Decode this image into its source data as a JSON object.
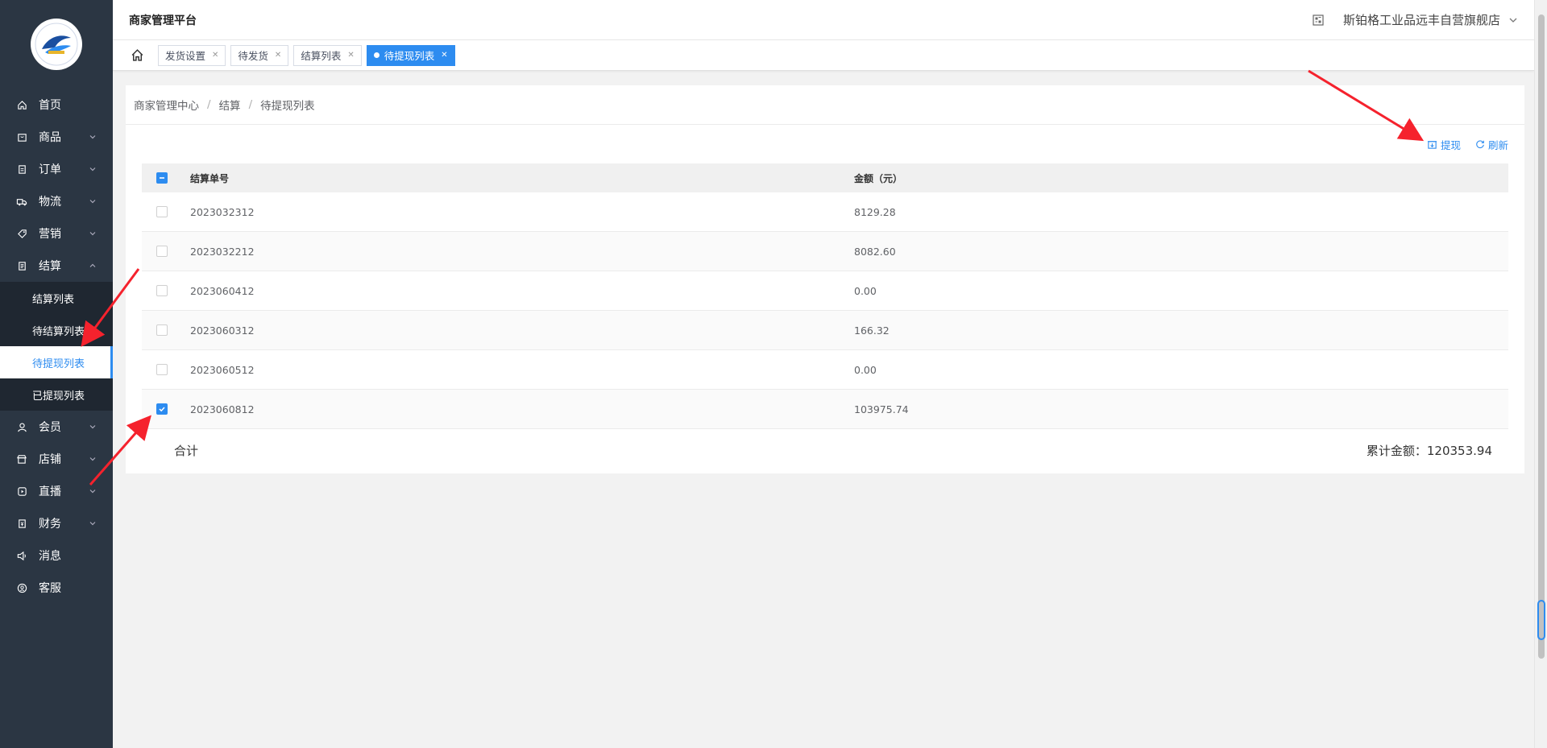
{
  "app": {
    "title": "商家管理平台",
    "shop_name": "斯铂格工业品远丰自营旗舰店"
  },
  "sidebar": {
    "items": [
      {
        "label": "首页",
        "icon": "home-icon"
      },
      {
        "label": "商品",
        "icon": "goods-icon"
      },
      {
        "label": "订单",
        "icon": "order-icon"
      },
      {
        "label": "物流",
        "icon": "truck-icon"
      },
      {
        "label": "营销",
        "icon": "tag-icon"
      },
      {
        "label": "结算",
        "icon": "settlement-icon"
      },
      {
        "label": "会员",
        "icon": "user-icon"
      },
      {
        "label": "店铺",
        "icon": "store-icon"
      },
      {
        "label": "直播",
        "icon": "live-icon"
      },
      {
        "label": "财务",
        "icon": "finance-icon"
      },
      {
        "label": "消息",
        "icon": "speaker-icon"
      },
      {
        "label": "客服",
        "icon": "service-icon"
      }
    ],
    "sub_items": [
      "结算列表",
      "待结算列表",
      "待提现列表",
      "已提现列表"
    ]
  },
  "tags": [
    "发货设置",
    "待发货",
    "结算列表",
    "待提现列表"
  ],
  "breadcrumb": [
    "商家管理中心",
    "结算",
    "待提现列表"
  ],
  "toolbar": {
    "withdraw": "提现",
    "refresh": "刷新"
  },
  "table": {
    "headers": {
      "id": "结算单号",
      "amount": "金额（元）"
    },
    "rows": [
      {
        "id": "2023032312",
        "amount": "8129.28"
      },
      {
        "id": "2023032212",
        "amount": "8082.60"
      },
      {
        "id": "2023060412",
        "amount": "0.00"
      },
      {
        "id": "2023060312",
        "amount": "166.32"
      },
      {
        "id": "2023060512",
        "amount": "0.00"
      },
      {
        "id": "2023060812",
        "amount": "103975.74"
      }
    ],
    "checked_rows": [
      false,
      false,
      false,
      false,
      false,
      true
    ]
  },
  "summary": {
    "label": "合计",
    "total_label": "累计金额：",
    "total_value": "120353.94"
  },
  "colors": {
    "sidebar": "#2b3643",
    "accent": "#2d8cf0",
    "arrow": "#f5222d"
  }
}
